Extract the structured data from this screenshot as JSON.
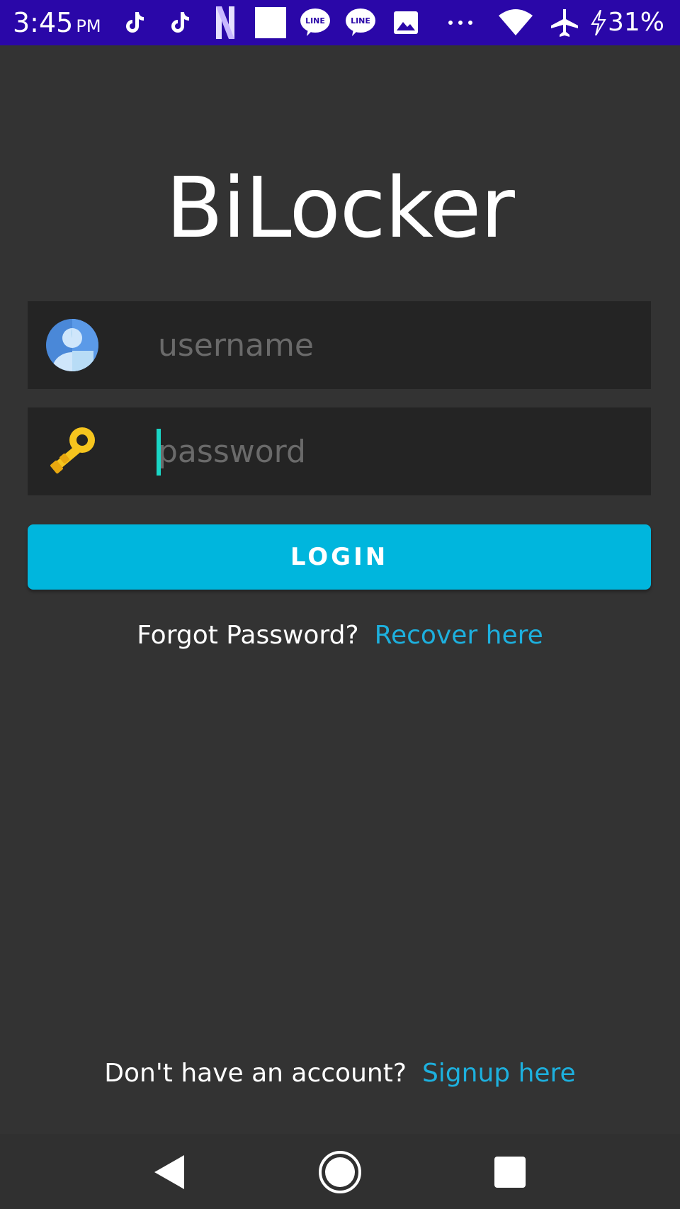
{
  "status_bar": {
    "time": "3:45",
    "ampm": "PM",
    "battery": "31%",
    "icons": [
      "tiktok-icon",
      "tiktok-icon",
      "netflix-icon",
      "white-square-icon",
      "line-icon",
      "line-icon",
      "gallery-icon",
      "more-dots-icon",
      "wifi-icon",
      "airplane-mode-icon",
      "charging-icon"
    ],
    "color": "#2a07a8"
  },
  "app": {
    "title": "BiLocker",
    "background": "#333333"
  },
  "login_form": {
    "username_placeholder": "username",
    "username_value": "",
    "password_placeholder": "password",
    "password_value": "",
    "login_label": "LOGIN",
    "accent_color": "#00b6dd"
  },
  "forgot": {
    "prompt": "Forgot Password?",
    "link": "Recover here"
  },
  "signup": {
    "prompt": "Don't have an account?",
    "link": "Signup here"
  },
  "nav_bar": {
    "buttons": [
      "back-icon",
      "home-icon",
      "recents-icon"
    ]
  }
}
